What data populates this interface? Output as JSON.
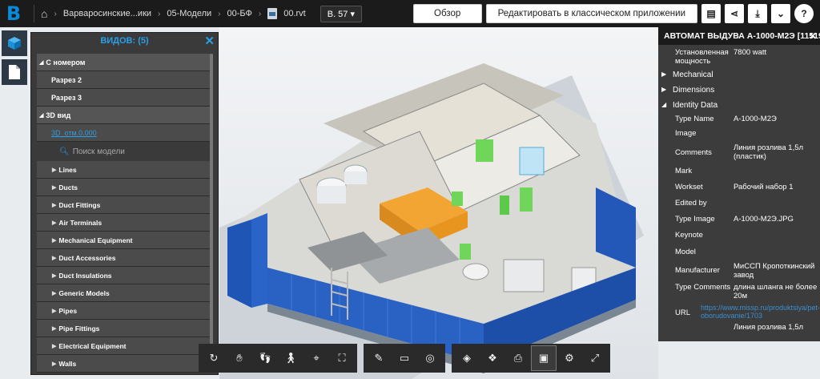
{
  "app": {
    "logo_letter": "B"
  },
  "breadcrumb": {
    "items": [
      "Варваросинские...ики",
      "05-Модели",
      "00-БФ",
      "00.rvt"
    ]
  },
  "version": "В. 57",
  "header": {
    "overview_button": "Обзор",
    "edit_classic_button": "Редактировать в классическом приложении"
  },
  "tree": {
    "title": "ВИДОВ: (5)",
    "group1": "С номером",
    "group1_items": [
      "Разрез 2",
      "Разрез 3"
    ],
    "group2": "3D вид",
    "group2_items": [
      "3D_отм.0.000"
    ],
    "search_placeholder": "Поиск модели",
    "categories": [
      "Lines",
      "Ducts",
      "Duct Fittings",
      "Air Terminals",
      "Mechanical Equipment",
      "Duct Accessories",
      "Duct Insulations",
      "Generic Models",
      "Pipes",
      "Pipe Fittings",
      "Electrical Equipment",
      "Walls"
    ]
  },
  "props": {
    "title": "АВТОМАТ ВЫДУВА А-1000-М2Э [11519",
    "installed_power_label": "Установленная мощность",
    "installed_power_value": "7800 watt",
    "sections": [
      "Mechanical",
      "Dimensions",
      "Identity Data"
    ],
    "rows": [
      {
        "k": "Type Name",
        "v": "А-1000-М2Э"
      },
      {
        "k": "Image",
        "v": ""
      },
      {
        "k": "Comments",
        "v": "Линия розлива 1,5л (пластик)"
      },
      {
        "k": "Mark",
        "v": ""
      },
      {
        "k": "Workset",
        "v": "Рабочий набор 1"
      },
      {
        "k": "Edited by",
        "v": ""
      },
      {
        "k": "Type Image",
        "v": "А-1000-М2Э.JPG"
      },
      {
        "k": "Keynote",
        "v": ""
      },
      {
        "k": "Model",
        "v": ""
      },
      {
        "k": "Manufacturer",
        "v": "МиССП Кропоткинский завод"
      },
      {
        "k": "Type Comments",
        "v": "длина шланга не более 20м"
      }
    ],
    "url_label": "URL",
    "url_value": "https://www.missp.ru/produktsiya/pet-oborudovanie/1703",
    "last_value": "Линия розлива 1,5л"
  },
  "colors": {
    "accent": "#2aa0e6",
    "panel": "#3a3a3a",
    "topbar": "#1b1b1b"
  }
}
